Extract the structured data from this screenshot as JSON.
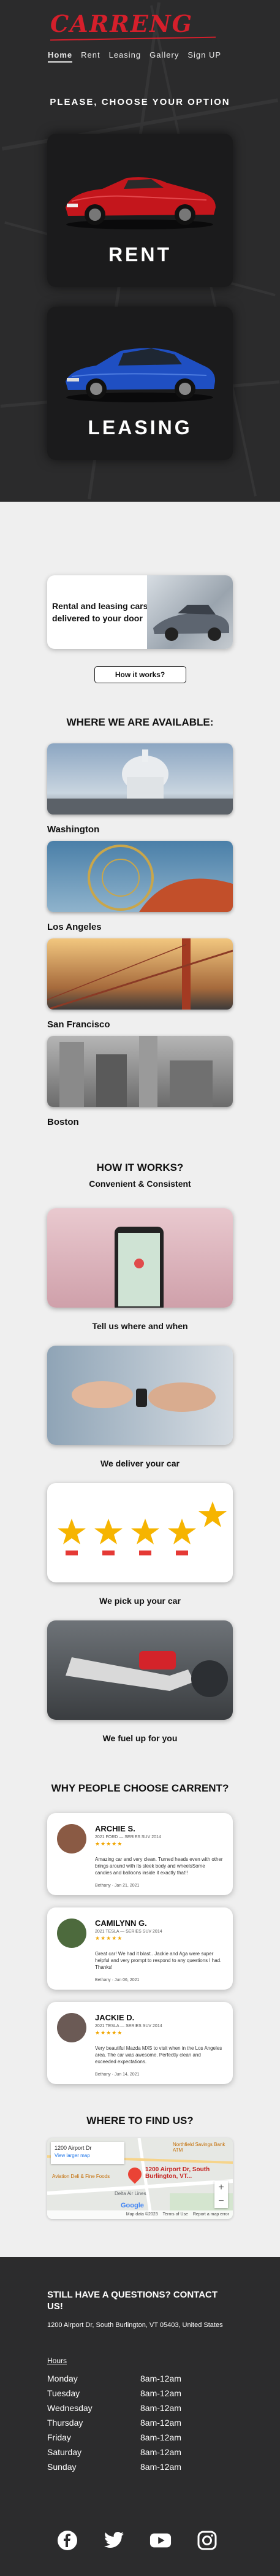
{
  "brand": {
    "logo": "CARRENG",
    "accent": "#d51f2b"
  },
  "nav": [
    {
      "label": "Home",
      "active": true
    },
    {
      "label": "Rent"
    },
    {
      "label": "Leasing"
    },
    {
      "label": "Gallery"
    },
    {
      "label": "Sign UP"
    }
  ],
  "hero": {
    "title": "PLEASE, CHOOSE YOUR OPTION",
    "options": [
      {
        "label": "RENT"
      },
      {
        "label": "LEASING"
      }
    ]
  },
  "intro": {
    "text": "Rental and leasing cars delivered to your door",
    "button": "How it works?"
  },
  "locations": {
    "title": "WHERE WE ARE AVAILABLE:",
    "cities": [
      "Washington",
      "Los Angeles",
      "San Francisco",
      "Boston"
    ]
  },
  "how": {
    "title": "HOW IT WORKS?",
    "subtitle": "Convenient & Consistent",
    "steps": [
      "Tell us where and when",
      "We deliver your car",
      "We pick up your car",
      "We fuel up for you"
    ]
  },
  "reviews": {
    "title": "WHY PEOPLE CHOOSE CARRENT?",
    "items": [
      {
        "name": "ARCHIE S.",
        "meta": "2021 FORD — SERIES SUV 2014",
        "text": "Amazing car and very clean. Turned heads even with other brings around with its sleek body and wheelsSome candies and balloons inside it exactly that!!",
        "footer": "Bethany · Jan 21, 2021"
      },
      {
        "name": "CAMILYNN G.",
        "meta": "2021 TESLA — SERIES SUV 2014",
        "text": "Great car! We had it blast.. Jackie and Aga were super helpful and very prompt to respond to any questions I had. Thanks!",
        "footer": "Bethany · Jun 06, 2021"
      },
      {
        "name": "JACKIE D.",
        "meta": "2021 TESLA — SERIES SUV 2014",
        "text": "Very beautiful Mazda MX5 to visit when in the Los Angeles area. The car was awesome. Perfectly clean and exceeded expectations.",
        "footer": "Bethany · Jun 14, 2021"
      }
    ]
  },
  "find": {
    "title": "WHERE TO FIND US?",
    "map_address": "1200 Airport Dr",
    "map_link": "View larger map",
    "pin_label": "1200 Airport Dr, South Burlington, VT...",
    "poi_1": "Northfield Savings Bank ATM",
    "poi_2": "Delta Air Lines",
    "poi_3": "Aviation Deli & Fine Foods",
    "map_footer": [
      "Map data ©2023",
      "Terms of Use",
      "Report a map error"
    ],
    "google": "Google"
  },
  "footer": {
    "title": "STILL HAVE A QUESTIONS? CONTACT US!",
    "address": "1200 Airport Dr, South Burlington, VT 05403, United States",
    "hours_label": "Hours",
    "hours": [
      {
        "day": "Monday",
        "time": "8am-12am"
      },
      {
        "day": "Tuesday",
        "time": "8am-12am"
      },
      {
        "day": "Wednesday",
        "time": "8am-12am"
      },
      {
        "day": "Thursday",
        "time": "8am-12am"
      },
      {
        "day": "Friday",
        "time": "8am-12am"
      },
      {
        "day": "Saturday",
        "time": "8am-12am"
      },
      {
        "day": "Sunday",
        "time": "8am-12am"
      }
    ],
    "social": [
      "facebook-icon",
      "twitter-icon",
      "youtube-icon",
      "instagram-icon"
    ]
  }
}
